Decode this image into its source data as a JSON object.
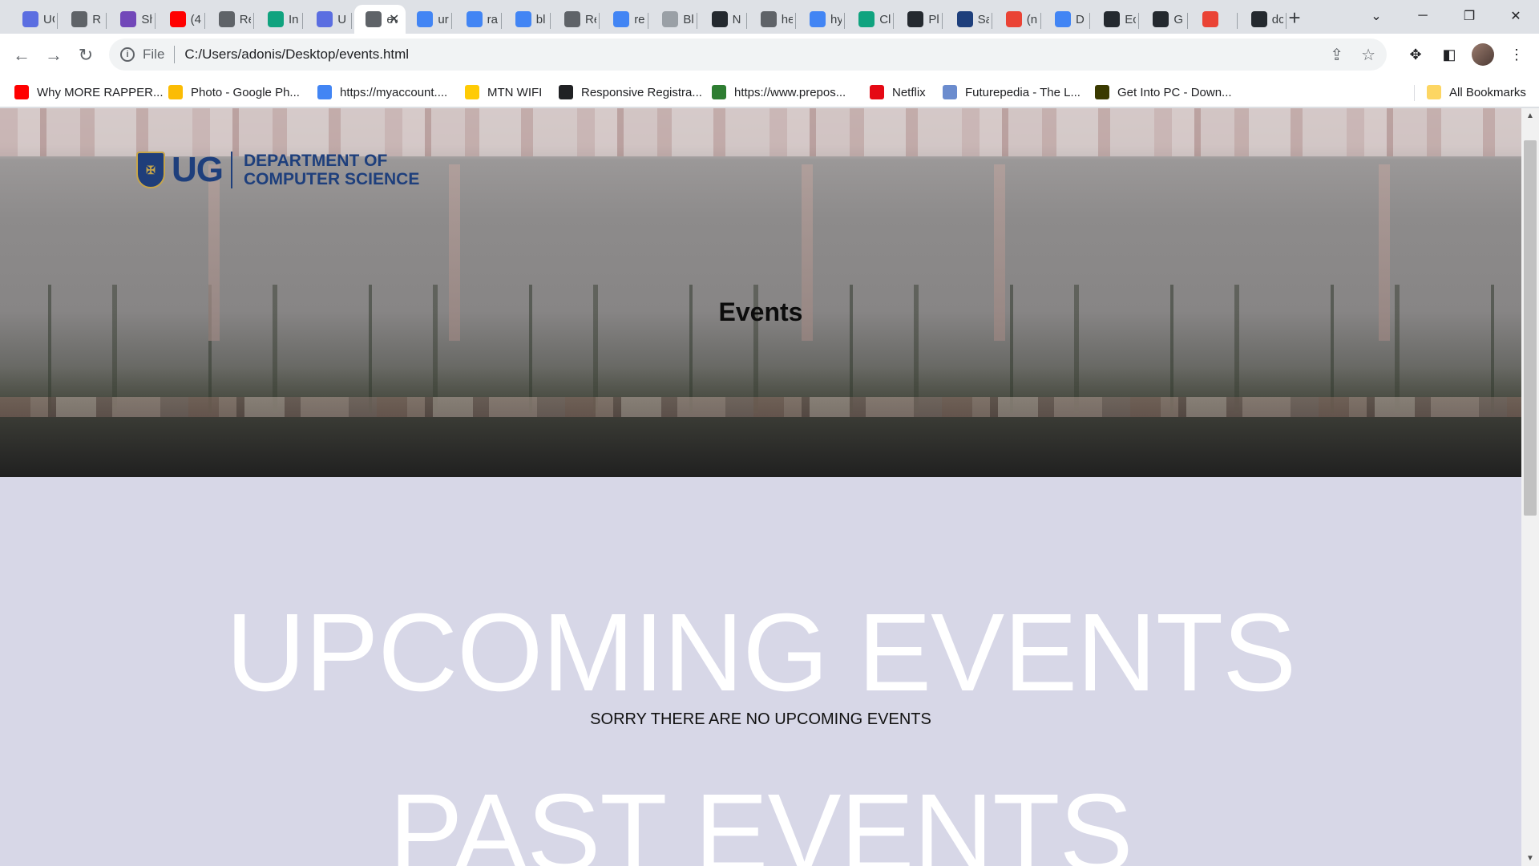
{
  "tabs": [
    {
      "label": "UG",
      "icon": "ug-icon",
      "color": "#5b6ee1"
    },
    {
      "label": "R",
      "icon": "globe-icon",
      "color": "#5f6368"
    },
    {
      "label": "Sh",
      "icon": "forms-icon",
      "color": "#7248b9"
    },
    {
      "label": "(4",
      "icon": "youtube-icon",
      "color": "#ff0000"
    },
    {
      "label": "Re",
      "icon": "globe-icon",
      "color": "#5f6368"
    },
    {
      "label": "In",
      "icon": "chatgpt-icon",
      "color": "#10a37f"
    },
    {
      "label": "U",
      "icon": "ug-icon",
      "color": "#5b6ee1"
    },
    {
      "label": "ev",
      "icon": "file-icon",
      "color": "#5f6368"
    },
    {
      "label": "ur",
      "icon": "google-icon",
      "color": "#4285f4"
    },
    {
      "label": "ra",
      "icon": "google-icon",
      "color": "#4285f4"
    },
    {
      "label": "bl",
      "icon": "google-icon",
      "color": "#4285f4"
    },
    {
      "label": "Re",
      "icon": "globe-icon",
      "color": "#5f6368"
    },
    {
      "label": "re",
      "icon": "google-icon",
      "color": "#4285f4"
    },
    {
      "label": "Bl",
      "icon": "dots-icon",
      "color": "#9aa0a6"
    },
    {
      "label": "N",
      "icon": "github-icon",
      "color": "#24292f"
    },
    {
      "label": "he",
      "icon": "globe-icon",
      "color": "#5f6368"
    },
    {
      "label": "hy",
      "icon": "google-icon",
      "color": "#4285f4"
    },
    {
      "label": "Cl",
      "icon": "chatgpt-icon",
      "color": "#10a37f"
    },
    {
      "label": "Pl",
      "icon": "github-icon",
      "color": "#24292f"
    },
    {
      "label": "Sa",
      "icon": "crest-icon",
      "color": "#1e3f7c"
    },
    {
      "label": "(n",
      "icon": "gmail-icon",
      "color": "#ea4335"
    },
    {
      "label": "D",
      "icon": "docs-icon",
      "color": "#4285f4"
    },
    {
      "label": "Ec",
      "icon": "github-icon",
      "color": "#24292f"
    },
    {
      "label": "G",
      "icon": "github-icon",
      "color": "#24292f"
    },
    {
      "label": "",
      "icon": "gmail-icon",
      "color": "#ea4335"
    },
    {
      "label": "dc",
      "icon": "github-icon",
      "color": "#24292f"
    }
  ],
  "active_tab_index": 7,
  "address": {
    "scheme": "File",
    "url": "C:/Users/adonis/Desktop/events.html"
  },
  "bookmarks": [
    {
      "label": "Why MORE RAPPER...",
      "icon": "youtube-icon",
      "color": "#ff0000"
    },
    {
      "label": "Photo - Google Ph...",
      "icon": "photos-icon",
      "color": "#fbbc04"
    },
    {
      "label": "https://myaccount....",
      "icon": "google-icon",
      "color": "#4285f4"
    },
    {
      "label": "MTN WIFI",
      "icon": "mtn-icon",
      "color": "#ffcb05"
    },
    {
      "label": "Responsive Registra...",
      "icon": "globe-icon",
      "color": "#202124"
    },
    {
      "label": "https://www.prepos...",
      "icon": "prepostseo-icon",
      "color": "#2e7d32"
    },
    {
      "label": "Netflix",
      "icon": "netflix-icon",
      "color": "#e50914"
    },
    {
      "label": "Futurepedia - The L...",
      "icon": "futurepedia-icon",
      "color": "#6b8cce"
    },
    {
      "label": "Get Into PC - Down...",
      "icon": "getintopc-icon",
      "color": "#3a3a00"
    }
  ],
  "all_bookmarks_label": "All Bookmarks",
  "page": {
    "logo_short": "UG",
    "logo_line1": "DEPARTMENT OF",
    "logo_line2": "COMPUTER SCIENCE",
    "hero_title": "Events",
    "upcoming_title": "UPCOMING EVENTS",
    "upcoming_message": "SORRY THERE ARE NO UPCOMING EVENTS",
    "past_title": "PAST EVENTS"
  },
  "colors": {
    "page_background": "#d7d7e7",
    "logo_blue": "#1e3f7c",
    "heading_white": "#ffffff"
  }
}
